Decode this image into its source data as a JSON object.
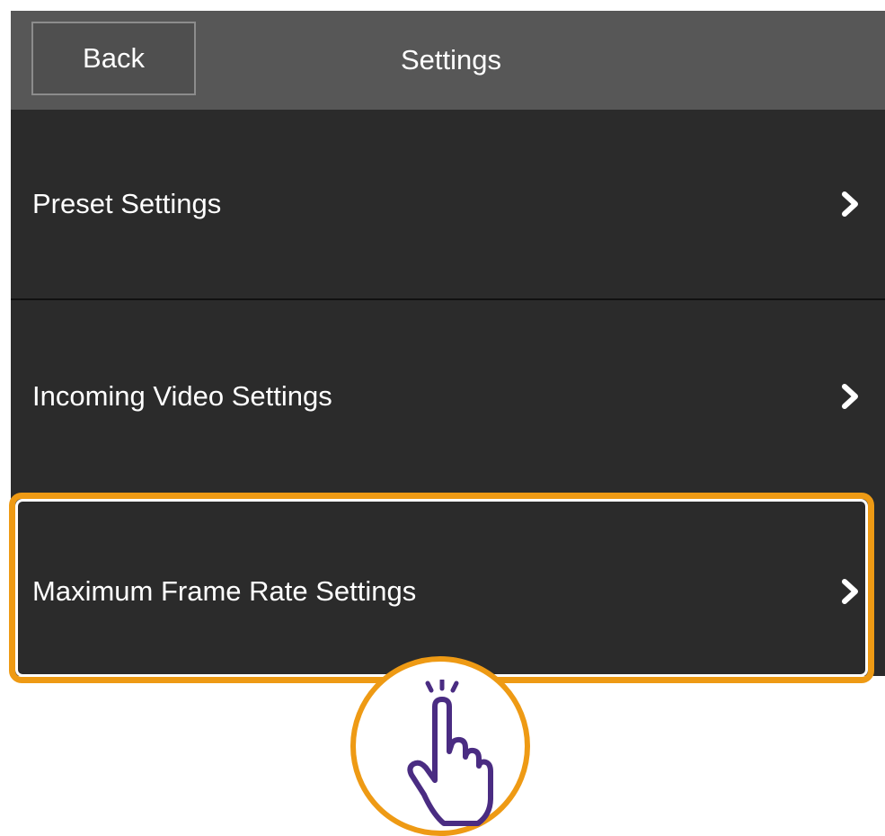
{
  "header": {
    "back_label": "Back",
    "title": "Settings"
  },
  "menu": {
    "items": [
      {
        "label": "Preset Settings",
        "icon": "chevron-right-icon"
      },
      {
        "label": "Incoming Video Settings",
        "icon": "chevron-right-icon"
      },
      {
        "label": "Maximum Frame Rate Settings",
        "icon": "chevron-right-icon"
      }
    ]
  },
  "annotation": {
    "highlighted_item": "Maximum Frame Rate Settings",
    "highlight_color": "#ee9a14",
    "hint_icon": "tap-hand-icon",
    "hint_icon_color": "#4a2c82"
  },
  "colors": {
    "header_bg": "#575757",
    "list_bg": "#2b2b2b",
    "text": "#ffffff"
  }
}
